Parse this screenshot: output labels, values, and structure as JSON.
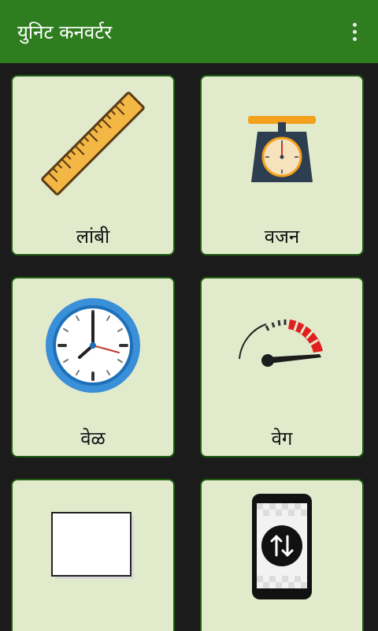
{
  "appbar": {
    "title": "युनिट कनवर्टर",
    "color": "#2e7d1f"
  },
  "cards": [
    {
      "label": "लांबी",
      "icon": "ruler-icon"
    },
    {
      "label": "वजन",
      "icon": "weighing-scale-icon"
    },
    {
      "label": "वेळ",
      "icon": "clock-icon"
    },
    {
      "label": "वेग",
      "icon": "speedometer-icon"
    },
    {
      "label": "",
      "icon": "area-square-icon"
    },
    {
      "label": "",
      "icon": "data-transfer-phone-icon"
    }
  ],
  "colors": {
    "background": "#1b1b1b",
    "card_fill": "#e1ebcc",
    "card_border": "#1f5d12"
  }
}
